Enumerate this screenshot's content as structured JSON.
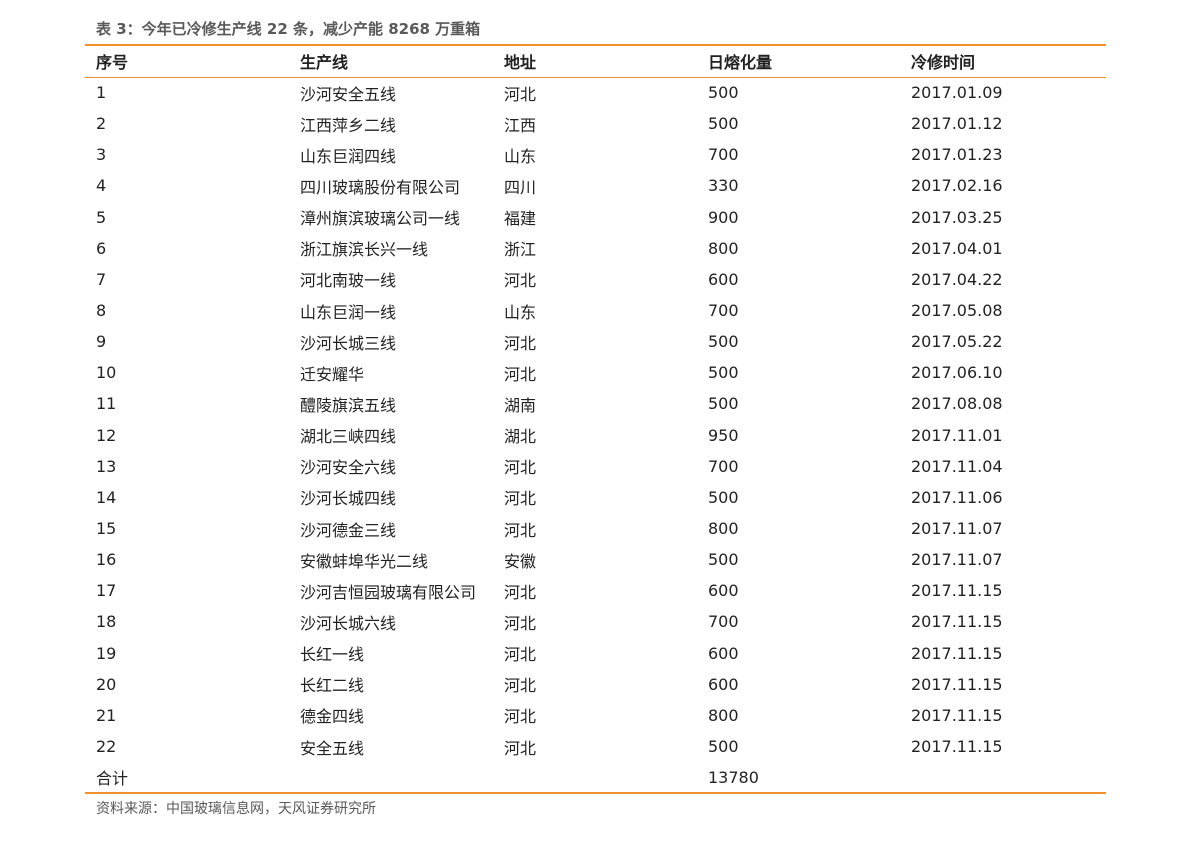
{
  "caption": "表 3：今年已冷修生产线 22 条，减少产能 8268 万重箱",
  "table": {
    "headers": [
      "序号",
      "生产线",
      "地址",
      "日熔化量",
      "冷修时间"
    ],
    "rows": [
      [
        "1",
        "沙河安全五线",
        "河北",
        "500",
        "2017.01.09"
      ],
      [
        "2",
        "江西萍乡二线",
        "江西",
        "500",
        "2017.01.12"
      ],
      [
        "3",
        "山东巨润四线",
        "山东",
        "700",
        "2017.01.23"
      ],
      [
        "4",
        "四川玻璃股份有限公司",
        "四川",
        "330",
        "2017.02.16"
      ],
      [
        "5",
        "漳州旗滨玻璃公司一线",
        "福建",
        "900",
        "2017.03.25"
      ],
      [
        "6",
        "浙江旗滨长兴一线",
        "浙江",
        "800",
        "2017.04.01"
      ],
      [
        "7",
        "河北南玻一线",
        "河北",
        "600",
        "2017.04.22"
      ],
      [
        "8",
        "山东巨润一线",
        "山东",
        "700",
        "2017.05.08"
      ],
      [
        "9",
        "沙河长城三线",
        "河北",
        "500",
        "2017.05.22"
      ],
      [
        "10",
        "迁安耀华",
        "河北",
        "500",
        "2017.06.10"
      ],
      [
        "11",
        "醴陵旗滨五线",
        "湖南",
        "500",
        "2017.08.08"
      ],
      [
        "12",
        "湖北三峡四线",
        "湖北",
        "950",
        "2017.11.01"
      ],
      [
        "13",
        "沙河安全六线",
        "河北",
        "700",
        "2017.11.04"
      ],
      [
        "14",
        "沙河长城四线",
        "河北",
        "500",
        "2017.11.06"
      ],
      [
        "15",
        "沙河德金三线",
        "河北",
        "800",
        "2017.11.07"
      ],
      [
        "16",
        "安徽蚌埠华光二线",
        "安徽",
        "500",
        "2017.11.07"
      ],
      [
        "17",
        "沙河吉恒园玻璃有限公司",
        "河北",
        "600",
        "2017.11.15"
      ],
      [
        "18",
        "沙河长城六线",
        "河北",
        "700",
        "2017.11.15"
      ],
      [
        "19",
        "长红一线",
        "河北",
        "600",
        "2017.11.15"
      ],
      [
        "20",
        "长红二线",
        "河北",
        "600",
        "2017.11.15"
      ],
      [
        "21",
        "德金四线",
        "河北",
        "800",
        "2017.11.15"
      ],
      [
        "22",
        "安全五线",
        "河北",
        "500",
        "2017.11.15"
      ]
    ],
    "total": [
      "合计",
      "",
      "",
      "13780",
      ""
    ]
  },
  "source": "资料来源：中国玻璃信息网，天风证券研究所",
  "colors": {
    "rule": "#f0922b",
    "caption_text": "#595959",
    "body_text": "#222222"
  }
}
